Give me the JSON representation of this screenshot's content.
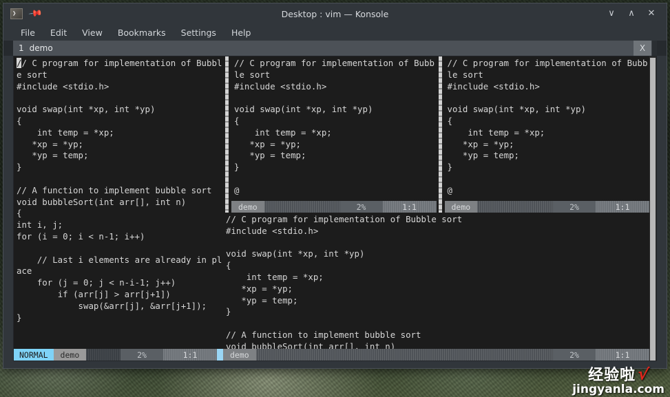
{
  "window": {
    "title": "Desktop : vim — Konsole",
    "app_icon": "terminal-icon",
    "pin_icon": "pin-icon",
    "controls": {
      "minimize": "∨",
      "maximize": "∧",
      "close": "✕"
    }
  },
  "menubar": {
    "items": [
      {
        "label": "File"
      },
      {
        "label": "Edit"
      },
      {
        "label": "View"
      },
      {
        "label": "Bookmarks"
      },
      {
        "label": "Settings"
      },
      {
        "label": "Help"
      }
    ]
  },
  "tabbar": {
    "tab_number": "1",
    "tab_label": "demo",
    "close_label": "X"
  },
  "panes": {
    "left": {
      "code_head": "/",
      "code": "/ C program for implementation of Bubble sort\n#include <stdio.h>\n\nvoid swap(int *xp, int *yp)\n{\n    int temp = *xp;\n   *xp = *yp;\n   *yp = temp;\n}\n\n// A function to implement bubble sort\nvoid bubbleSort(int arr[], int n)\n{\nint i, j;\nfor (i = 0; i < n-1; i++)\n\n    // Last i elements are already in place\n    for (j = 0; j < n-i-1; j++)\n        if (arr[j] > arr[j+1])\n            swap(&arr[j], &arr[j+1]);\n}",
      "status": {
        "mode": "NORMAL",
        "file": "demo",
        "percent": "2%",
        "position": "1:1"
      }
    },
    "middle": {
      "code": "// C program for implementation of Bubble sort\n#include <stdio.h>\n\nvoid swap(int *xp, int *yp)\n{\n    int temp = *xp;\n   *xp = *yp;\n   *yp = temp;\n}\n\n@",
      "status": {
        "file": "demo",
        "percent": "2%",
        "position": "1:1"
      }
    },
    "right": {
      "code": "// C program for implementation of Bubble sort\n#include <stdio.h>\n\nvoid swap(int *xp, int *yp)\n{\n    int temp = *xp;\n   *xp = *yp;\n   *yp = temp;\n}\n\n@",
      "status": {
        "file": "demo",
        "percent": "2%",
        "position": "1:1"
      }
    },
    "bottom": {
      "code": "// C program for implementation of Bubble sort\n#include <stdio.h>\n\nvoid swap(int *xp, int *yp)\n{\n    int temp = *xp;\n   *xp = *yp;\n   *yp = temp;\n}\n\n// A function to implement bubble sort\nvoid bubbleSort(int arr[], int n)",
      "status": {
        "file": "demo",
        "percent": "2%",
        "position": "1:1"
      }
    }
  },
  "watermark": {
    "cn": "经验啦",
    "check": "√",
    "url": "jingyanla.com"
  },
  "colors": {
    "mode_badge": "#7fd3f7",
    "terminal_bg": "#1c1c1c",
    "window_chrome": "#31363b",
    "text": "#d6d6d6",
    "include_green": "#b3d6a0",
    "watermark_red": "#e1261c"
  }
}
